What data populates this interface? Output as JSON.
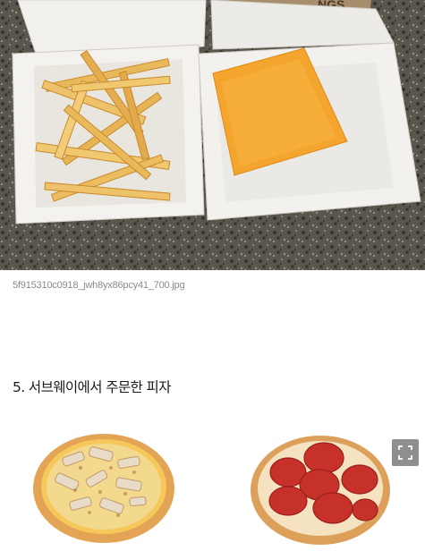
{
  "photo1": {
    "description_icon": "fries-and-cheese-photo",
    "caption": "5f915310c0918_jwh8yx86pcy41_700.jpg"
  },
  "section": {
    "heading": "5. 서브웨이에서 주문한 피자"
  },
  "photo2": {
    "description_icon": "two-pizzas-photo",
    "expand_icon": "expand-icon"
  }
}
